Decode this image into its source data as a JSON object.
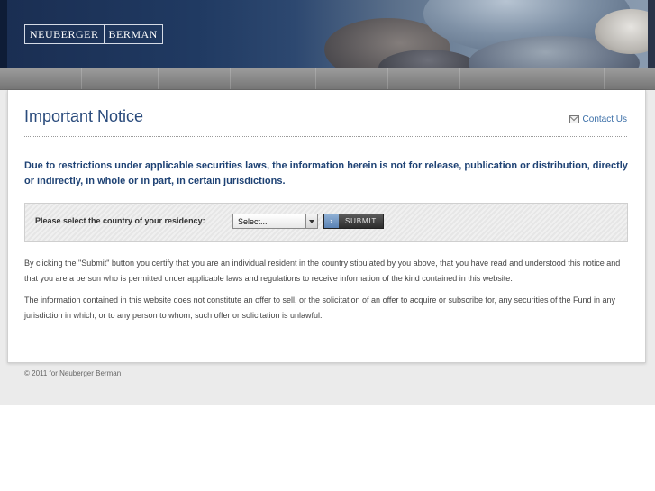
{
  "header": {
    "logo_left": "NEUBERGER",
    "logo_right": "BERMAN"
  },
  "notice": {
    "title": "Important Notice",
    "contact_label": "Contact Us",
    "lead": "Due to restrictions under applicable securities laws, the information herein is not for release, publication or distribution, directly or indirectly, in whole or in part, in certain jurisdictions."
  },
  "residency": {
    "label": "Please select the country of your residency:",
    "selected_value": "Select...",
    "submit_label": "SUBMIT",
    "submit_icon": "chevron-right-icon"
  },
  "body": {
    "paragraph1": "By clicking the \"Submit\" button you certify that you are an individual resident in the country stipulated by you above, that you have read and understood this notice and that you are a person who is permitted under applicable laws and regulations to receive information of the kind contained in this website.",
    "paragraph2": "The information contained in this website does not constitute an offer to sell, or the solicitation of an offer to acquire or subscribe for, any securities of the Fund in any jurisdiction in which, or to any person to whom, such offer or solicitation is unlawful."
  },
  "footer": {
    "copyright": "© 2011 for Neuberger Berman"
  },
  "colors": {
    "title": "#2a4b7c",
    "lead": "#1e4274",
    "link": "#3b6fa8"
  }
}
